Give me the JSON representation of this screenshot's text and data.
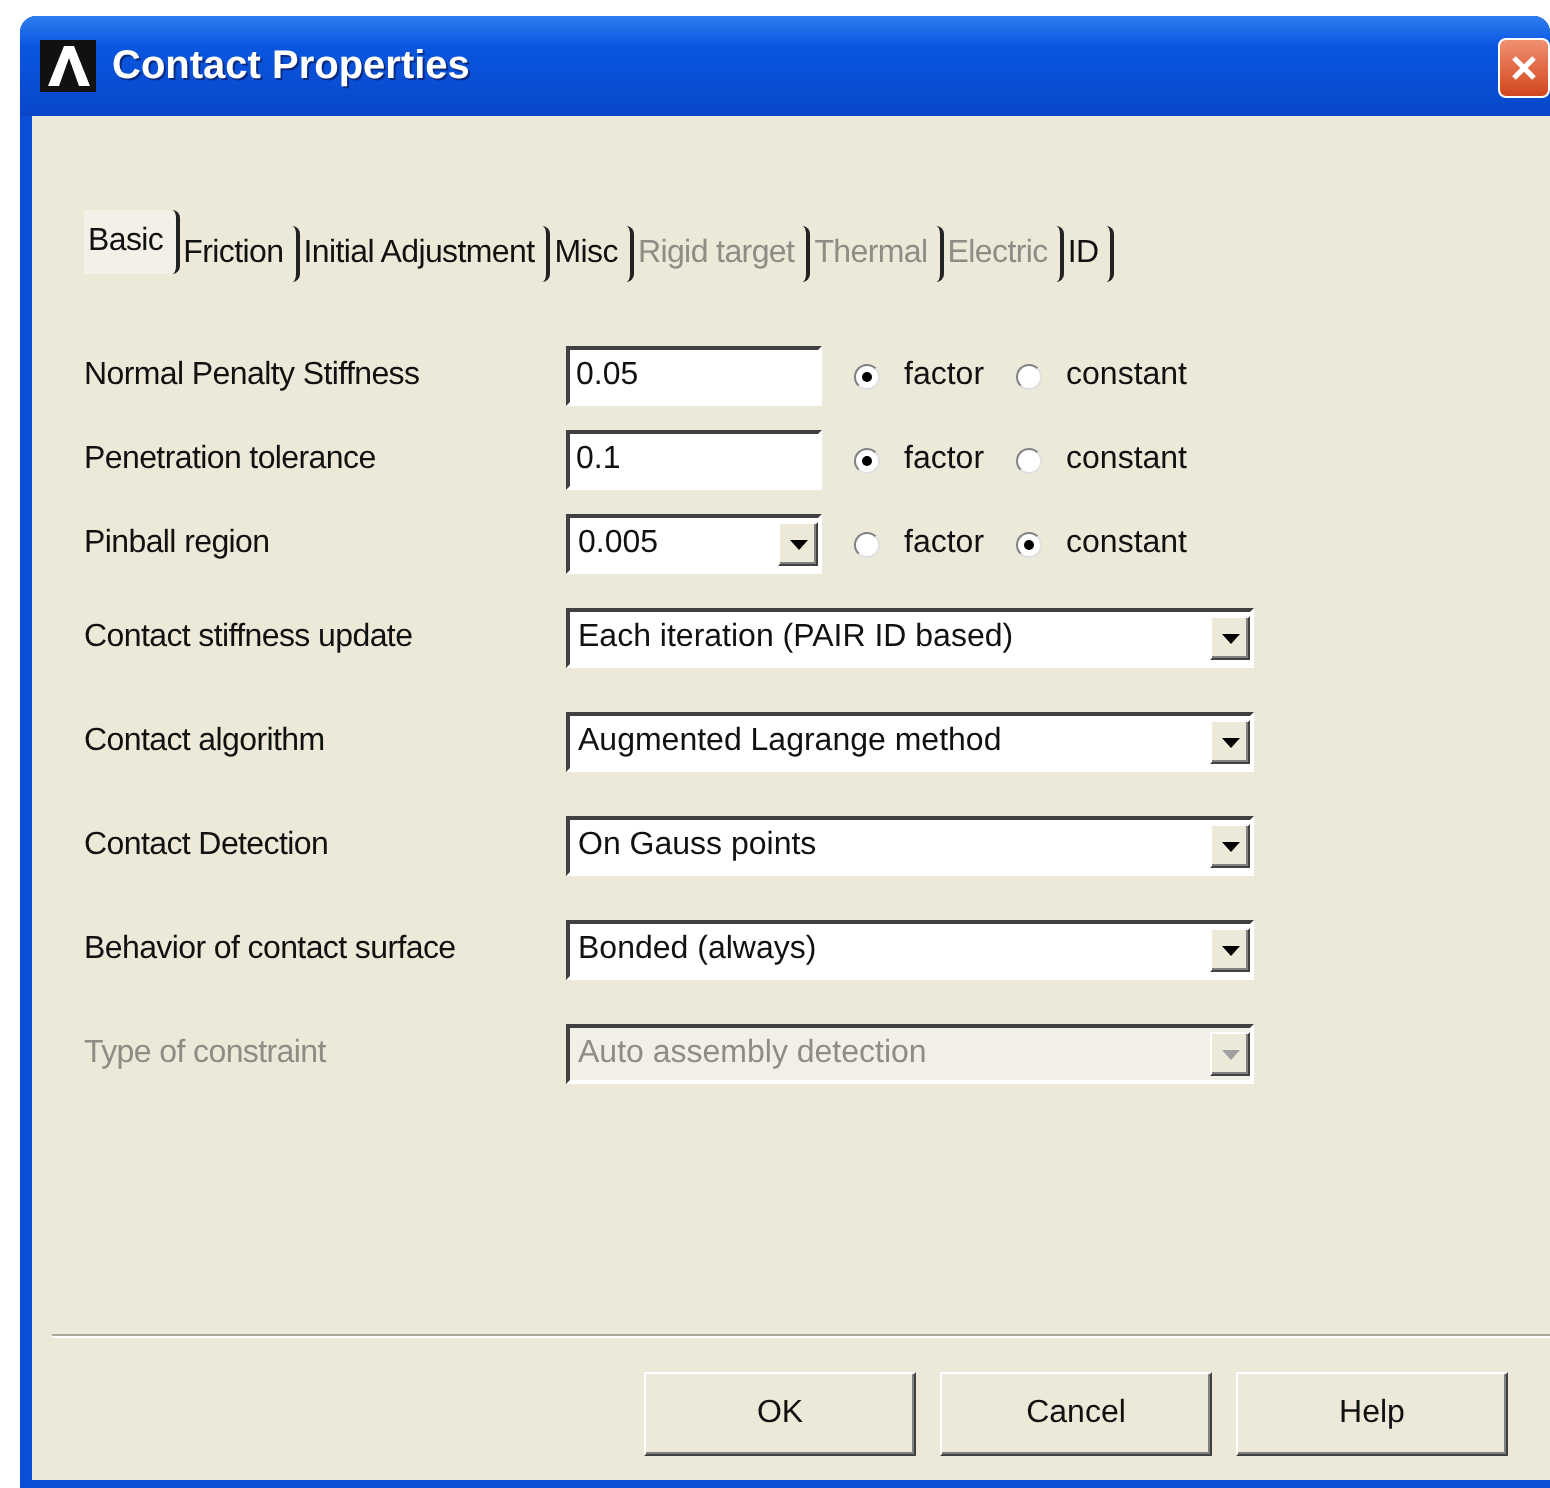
{
  "window": {
    "title": "Contact Properties"
  },
  "tabs": [
    {
      "label": "Basic",
      "selected": true,
      "disabled": false
    },
    {
      "label": "Friction",
      "selected": false,
      "disabled": false
    },
    {
      "label": "Initial Adjustment",
      "selected": false,
      "disabled": false
    },
    {
      "label": "Misc",
      "selected": false,
      "disabled": false
    },
    {
      "label": "Rigid target",
      "selected": false,
      "disabled": true
    },
    {
      "label": "Thermal",
      "selected": false,
      "disabled": true
    },
    {
      "label": "Electric",
      "selected": false,
      "disabled": true
    },
    {
      "label": "ID",
      "selected": false,
      "disabled": false
    }
  ],
  "rows": [
    {
      "kind": "input",
      "label": "Normal Penalty Stiffness",
      "value": "0.05",
      "disabled": false,
      "options": [
        {
          "label": "factor",
          "selected": true
        },
        {
          "label": "constant",
          "selected": false
        }
      ]
    },
    {
      "kind": "input",
      "label": "Penetration tolerance",
      "value": "0.1",
      "disabled": false,
      "options": [
        {
          "label": "factor",
          "selected": true
        },
        {
          "label": "constant",
          "selected": false
        }
      ]
    },
    {
      "kind": "combo",
      "label": "Pinball region",
      "value": "0.005",
      "disabled": false,
      "options": [
        {
          "label": "factor",
          "selected": false
        },
        {
          "label": "constant",
          "selected": true
        }
      ]
    },
    {
      "kind": "dropdown",
      "label": "Contact stiffness update",
      "value": "Each iteration (PAIR ID based)",
      "disabled": false
    },
    {
      "kind": "dropdown",
      "label": "Contact algorithm",
      "value": "Augmented Lagrange method",
      "disabled": false
    },
    {
      "kind": "dropdown",
      "label": "Contact Detection",
      "value": "On Gauss points",
      "disabled": false
    },
    {
      "kind": "dropdown",
      "label": "Behavior of contact surface",
      "value": "Bonded (always)",
      "disabled": false
    },
    {
      "kind": "dropdown",
      "label": "Type of constraint",
      "value": "Auto assembly detection",
      "disabled": true
    }
  ],
  "buttons": [
    "OK",
    "Cancel",
    "Help"
  ]
}
